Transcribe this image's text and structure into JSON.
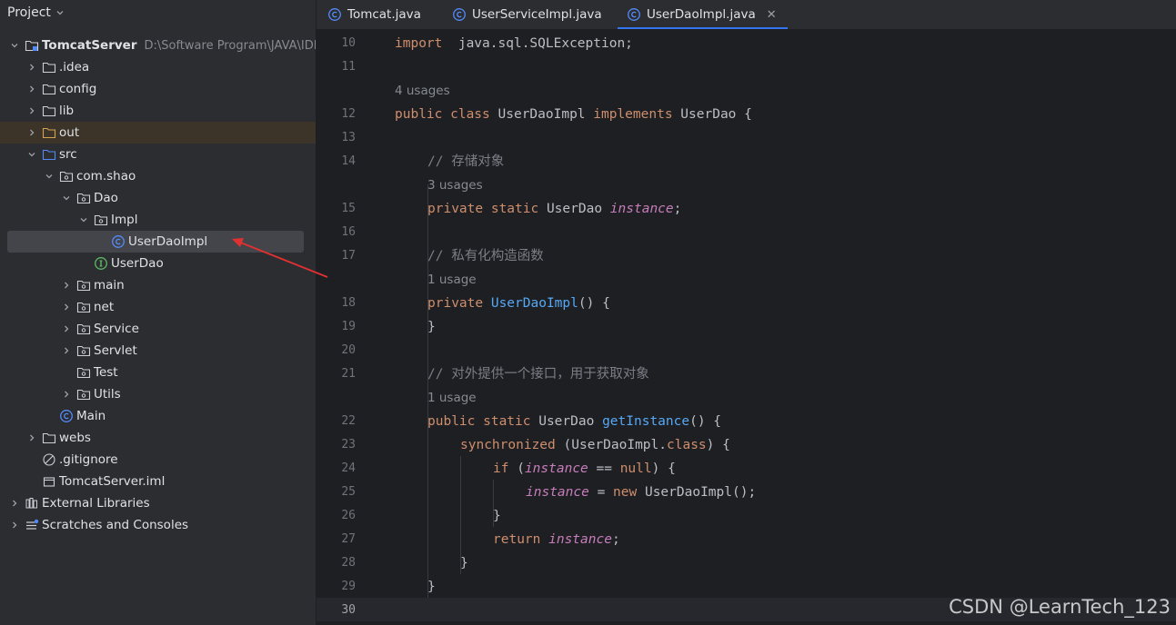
{
  "panel": {
    "title": "Project"
  },
  "tree": [
    {
      "label": "TomcatServer",
      "path": "D:\\Software Program\\JAVA\\IDEA\\",
      "depth": 0,
      "arrow": "down",
      "icon": "module-folder-icon",
      "name": "tree-item-tomcatserver"
    },
    {
      "label": ".idea",
      "depth": 1,
      "arrow": "right",
      "icon": "folder-icon",
      "name": "tree-item-idea"
    },
    {
      "label": "config",
      "depth": 1,
      "arrow": "right",
      "icon": "folder-icon",
      "name": "tree-item-config"
    },
    {
      "label": "lib",
      "depth": 1,
      "arrow": "right",
      "icon": "folder-icon",
      "name": "tree-item-lib"
    },
    {
      "label": "out",
      "depth": 1,
      "arrow": "right",
      "icon": "excluded-folder-icon",
      "name": "tree-item-out"
    },
    {
      "label": "src",
      "depth": 1,
      "arrow": "down",
      "icon": "source-folder-icon",
      "name": "tree-item-src"
    },
    {
      "label": "com.shao",
      "depth": 2,
      "arrow": "down",
      "icon": "package-icon",
      "name": "tree-item-com-shao"
    },
    {
      "label": "Dao",
      "depth": 3,
      "arrow": "down",
      "icon": "package-icon",
      "name": "tree-item-dao"
    },
    {
      "label": "Impl",
      "depth": 4,
      "arrow": "down",
      "icon": "package-icon",
      "name": "tree-item-impl"
    },
    {
      "label": "UserDaoImpl",
      "depth": 5,
      "arrow": "none",
      "icon": "class-icon",
      "name": "tree-item-userdaoimpl"
    },
    {
      "label": "UserDao",
      "depth": 4,
      "arrow": "none",
      "icon": "interface-icon",
      "name": "tree-item-userdao"
    },
    {
      "label": "main",
      "depth": 3,
      "arrow": "right",
      "icon": "package-icon",
      "name": "tree-item-main"
    },
    {
      "label": "net",
      "depth": 3,
      "arrow": "right",
      "icon": "package-icon",
      "name": "tree-item-net"
    },
    {
      "label": "Service",
      "depth": 3,
      "arrow": "right",
      "icon": "package-icon",
      "name": "tree-item-service"
    },
    {
      "label": "Servlet",
      "depth": 3,
      "arrow": "right",
      "icon": "package-icon",
      "name": "tree-item-servlet"
    },
    {
      "label": "Test",
      "depth": 3,
      "arrow": "none",
      "icon": "package-icon",
      "name": "tree-item-test"
    },
    {
      "label": "Utils",
      "depth": 3,
      "arrow": "right",
      "icon": "package-icon",
      "name": "tree-item-utils"
    },
    {
      "label": "Main",
      "depth": 2,
      "arrow": "none",
      "icon": "class-icon",
      "name": "tree-item-main-class"
    },
    {
      "label": "webs",
      "depth": 1,
      "arrow": "right",
      "icon": "folder-icon",
      "name": "tree-item-webs"
    },
    {
      "label": ".gitignore",
      "depth": 1,
      "arrow": "none",
      "icon": "ignore-file-icon",
      "name": "tree-item-gitignore"
    },
    {
      "label": "TomcatServer.iml",
      "depth": 1,
      "arrow": "none",
      "icon": "file-icon",
      "name": "tree-item-iml"
    },
    {
      "label": "External Libraries",
      "depth": 0,
      "arrow": "right",
      "icon": "libraries-icon",
      "name": "tree-item-external-libraries"
    },
    {
      "label": "Scratches and Consoles",
      "depth": 0,
      "arrow": "right",
      "icon": "scratches-icon",
      "name": "tree-item-scratches"
    }
  ],
  "tabs": [
    {
      "label": "Tomcat.java",
      "icon": "class-icon"
    },
    {
      "label": "UserServiceImpl.java",
      "icon": "class-icon"
    },
    {
      "label": "UserDaoImpl.java",
      "icon": "class-icon",
      "active": true
    }
  ],
  "editor": {
    "line_numbers": [
      "10",
      "11",
      "12",
      "13",
      "14",
      "15",
      "16",
      "17",
      "18",
      "19",
      "20",
      "21",
      "22",
      "23",
      "24",
      "25",
      "26",
      "27",
      "28",
      "29",
      "30"
    ],
    "hints": [
      "4 usages",
      "3 usages",
      "1 usage",
      "1 usage"
    ],
    "code": {
      "l10": [
        [
          "kw",
          "import"
        ],
        [
          "",
          "  java.sql.SQLException;"
        ]
      ],
      "l12": [
        [
          "kw",
          "public class "
        ],
        [
          "",
          "UserDaoImpl "
        ],
        [
          "kw",
          "implements "
        ],
        [
          "",
          "UserDao {"
        ]
      ],
      "l14": [
        [
          "cm",
          "// 存储对象"
        ]
      ],
      "l15": [
        [
          "kw",
          "private static "
        ],
        [
          "",
          "UserDao "
        ],
        [
          "fld",
          "instance"
        ],
        [
          "",
          ";"
        ]
      ],
      "l17": [
        [
          "cm",
          "// 私有化构造函数"
        ]
      ],
      "l18": [
        [
          "kw",
          "private "
        ],
        [
          "fn",
          "UserDaoImpl"
        ],
        [
          "",
          "() {"
        ]
      ],
      "l19": [
        [
          "",
          "}"
        ]
      ],
      "l21": [
        [
          "cm",
          "// 对外提供一个接口，用于获取对象"
        ]
      ],
      "l22": [
        [
          "kw",
          "public static "
        ],
        [
          "",
          "UserDao "
        ],
        [
          "fn",
          "getInstance"
        ],
        [
          "",
          "() {"
        ]
      ],
      "l23": [
        [
          "kw",
          "synchronized "
        ],
        [
          "",
          "(UserDaoImpl."
        ],
        [
          "kw",
          "class"
        ],
        [
          "",
          ") {"
        ]
      ],
      "l24": [
        [
          "kw",
          "if "
        ],
        [
          "",
          "("
        ],
        [
          "fld",
          "instance"
        ],
        [
          "",
          " == "
        ],
        [
          "kw",
          "null"
        ],
        [
          "",
          ") {"
        ]
      ],
      "l25": [
        [
          "fld",
          "instance"
        ],
        [
          "",
          " = "
        ],
        [
          "kw",
          "new "
        ],
        [
          "",
          "UserDaoImpl();"
        ]
      ],
      "l26": [
        [
          "",
          "}"
        ]
      ],
      "l27": [
        [
          "kw",
          "return "
        ],
        [
          "fld",
          "instance"
        ],
        [
          "",
          ";"
        ]
      ],
      "l28": [
        [
          "",
          "}"
        ]
      ],
      "l29": [
        [
          "",
          "}"
        ]
      ]
    }
  },
  "watermark": "CSDN @LearnTech_123",
  "colors": {
    "keyword": "#cf8e6d",
    "comment": "#7a7e85",
    "method": "#56a8f5",
    "field": "#c77dbb",
    "accent": "#3574f0",
    "annotation_arrow": "#e03131"
  }
}
